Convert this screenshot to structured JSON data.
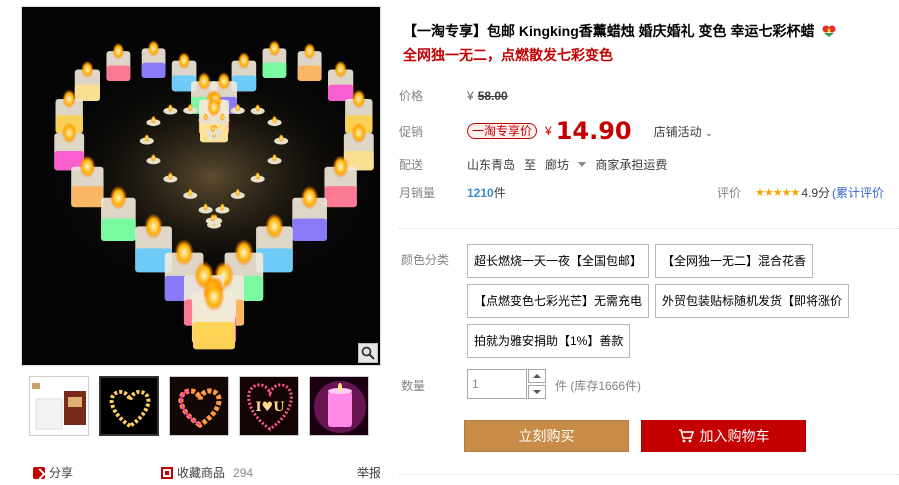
{
  "product": {
    "title": "【一淘专享】包邮 Kingking香薰蜡烛 婚庆婚礼 变色 幸运七彩杯蜡",
    "subtitle": "全网独一无二，点燃散发七彩变色"
  },
  "gallery": {
    "share_label": "分享",
    "favorite_label": "收藏商品",
    "favorite_count": "294",
    "report_label": "举报",
    "thumbnails": [
      "white-candle-box",
      "candle-heart-dark",
      "candle-heart-glow",
      "candle-i-love-you",
      "pink-candle-cup"
    ]
  },
  "price": {
    "original_label": "价格",
    "currency": "¥",
    "original_value": "58.00",
    "promo_label": "促销",
    "promo_tag": "一淘专享价",
    "promo_value": "14.90",
    "shop_activity": "店铺活动"
  },
  "shipping": {
    "label": "配送",
    "from": "山东青岛",
    "to_word": "至",
    "to": "廊坊",
    "fee": "商家承担运费"
  },
  "sales": {
    "label": "月销量",
    "count": "1210",
    "unit": "件",
    "rating_label": "评价",
    "stars": "★★★★★",
    "score": "4.9分",
    "reviews_link": "(累计评价"
  },
  "sku": {
    "label": "颜色分类",
    "options": [
      "超长燃烧一天一夜【全国包邮】",
      "【全网独一无二】混合花香",
      "【点燃变色七彩光芒】无需充电",
      "外贸包装贴标随机发货【即将涨价",
      "拍就为雅安捐助【1%】善款"
    ]
  },
  "quantity": {
    "label": "数量",
    "value": "1",
    "stock_text": "件 (库存1666件)"
  },
  "actions": {
    "buy_now": "立刻购买",
    "add_to_cart": "加入购物车"
  },
  "colors": {
    "accent_red": "#c40000",
    "buy_button": "#c78d48",
    "link_blue": "#3c8acc",
    "star_orange": "#f3a600"
  }
}
